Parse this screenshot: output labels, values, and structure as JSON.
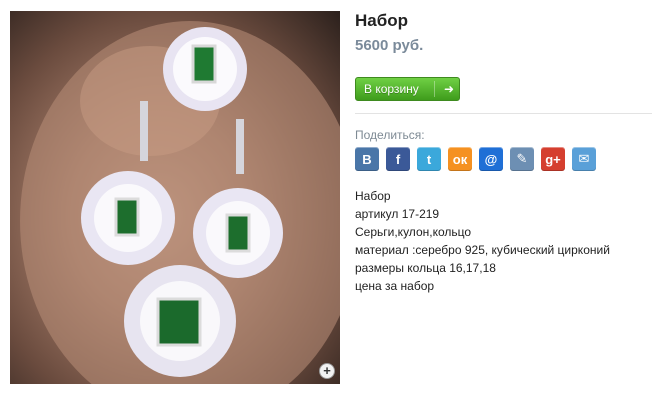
{
  "product": {
    "title": "Набор",
    "price": "5600 руб.",
    "zoom_glyph": "+"
  },
  "cart": {
    "label": "В корзину",
    "arrow": "➜"
  },
  "share": {
    "label": "Поделиться:",
    "buttons": [
      {
        "name": "vk",
        "glyph": "B",
        "color": "#4a76a8"
      },
      {
        "name": "facebook",
        "glyph": "f",
        "color": "#3b5998"
      },
      {
        "name": "twitter",
        "glyph": "t",
        "color": "#3ba8db"
      },
      {
        "name": "odnoklassniki",
        "glyph": "ок",
        "color": "#f59121"
      },
      {
        "name": "mail-ru",
        "glyph": "@",
        "color": "#1f6fd6"
      },
      {
        "name": "livejournal",
        "glyph": "✎",
        "color": "#6d8fb3"
      },
      {
        "name": "google-plus",
        "glyph": "g+",
        "color": "#d53f2f"
      },
      {
        "name": "email",
        "glyph": "✉",
        "color": "#5aa0d8"
      }
    ]
  },
  "description": {
    "lines": [
      "Набор",
      "артикул 17-219",
      "Серьги,кулон,кольцо",
      "материал :серебро 925, кубический цирконий",
      "размеры кольца 16,17,18",
      "цена за набор"
    ]
  }
}
